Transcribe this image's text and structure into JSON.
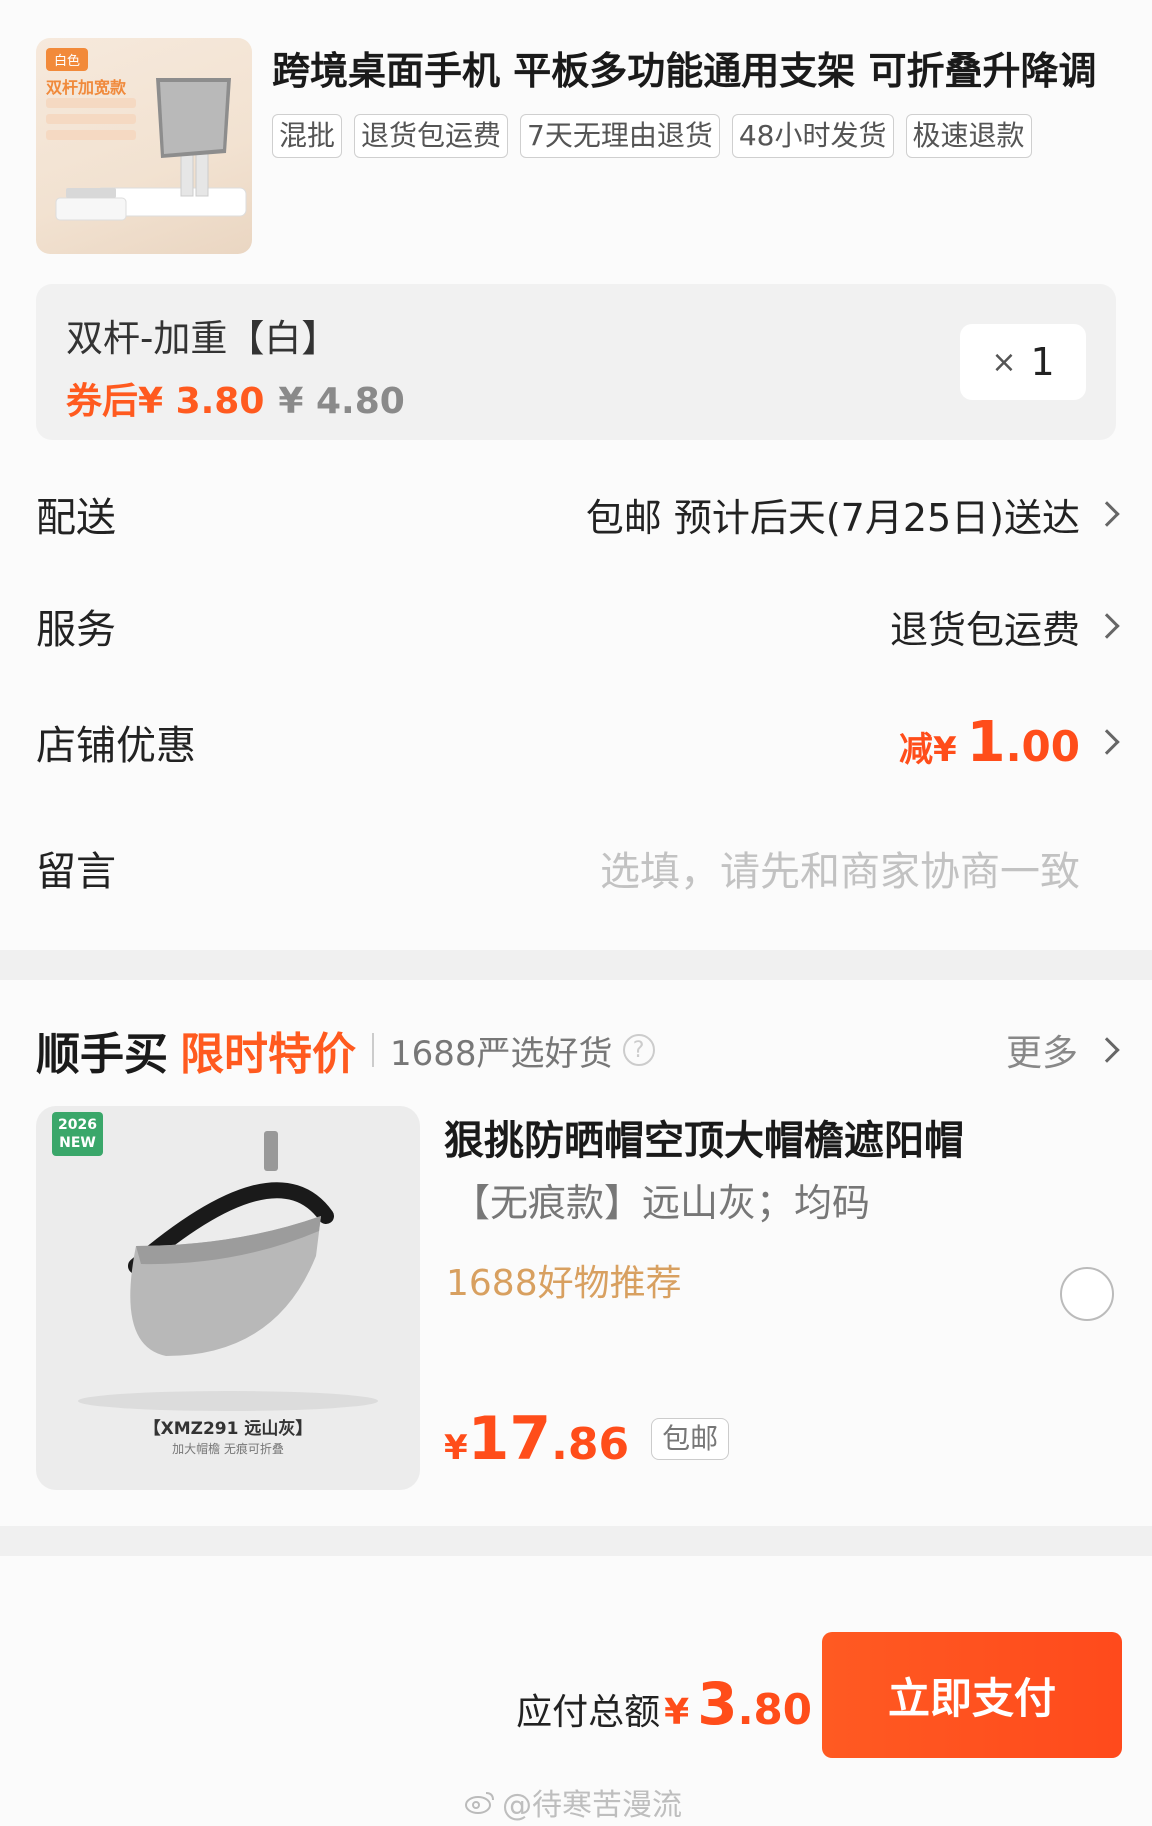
{
  "product": {
    "title": "跨境桌面手机 平板多功能通用支架 可折叠升降调",
    "thumb_tag": "白色",
    "thumb_title": "双杆加宽款",
    "tags": [
      "混批",
      "退货包运费",
      "7天无理由退货",
      "48小时发货",
      "极速退款"
    ]
  },
  "sku": {
    "name": "双杆-加重【白】",
    "coupon_price": "券后¥ 3.80",
    "original_price": "¥ 4.80",
    "qty_x": "×",
    "qty": "1"
  },
  "rows": {
    "delivery_label": "配送",
    "delivery_value": "包邮 预计后天(7月25日)送达",
    "service_label": "服务",
    "service_value": "退货包运费",
    "discount_label": "店铺优惠",
    "discount_prefix": "减¥",
    "discount_int": "1",
    "discount_dec": ".00",
    "message_label": "留言",
    "message_placeholder": "选填，请先和商家协商一致"
  },
  "shunshoumai": {
    "title": "顺手买",
    "subtitle": "限时特价",
    "desc": "1688严选好货",
    "help": "?",
    "more": "更多"
  },
  "recommend": {
    "badge_year": "2026",
    "badge_new": "NEW",
    "caption_model": "【XMZ291 远山灰】",
    "caption_sub": "加大帽檐 无痕可折叠",
    "title": "狠挑防晒帽空顶大帽檐遮阳帽",
    "spec": "【无痕款】远山灰；均码",
    "recommend_text": "1688好物推荐",
    "price_currency": "¥",
    "price_int": "17",
    "price_dec": ".86",
    "free_shipping": "包邮"
  },
  "footer": {
    "total_label": "应付总额",
    "total_currency": "¥",
    "total_int": "3",
    "total_dec": ".80",
    "pay_button": "立即支付",
    "watermark": "@待寒苦漫流"
  },
  "colors": {
    "accent": "#ff4d1a",
    "recommend_gold": "#d8a060"
  }
}
